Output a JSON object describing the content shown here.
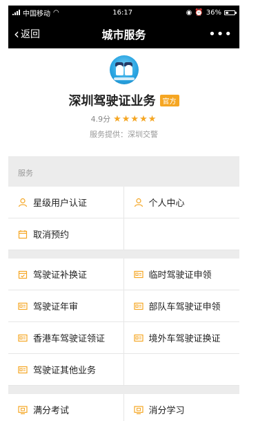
{
  "status_bar": {
    "carrier": "中国移动",
    "time": "16:17",
    "battery": "36%",
    "battery_level": 0.36
  },
  "nav": {
    "back_label": "返回",
    "title": "城市服务",
    "more_label": "•••"
  },
  "service": {
    "name": "深圳驾驶证业务",
    "badge": "官方",
    "score": "4.9分",
    "stars": "★★★★★",
    "provider": "服务提供：深圳交警"
  },
  "sections": {
    "services_title": "服务"
  },
  "group1": [
    {
      "label": "星级用户认证",
      "icon": "user-icon"
    },
    {
      "label": "个人中心",
      "icon": "user-icon"
    },
    {
      "label": "取消预约",
      "icon": "calendar-icon"
    }
  ],
  "group2": [
    {
      "label": "驾驶证补换证",
      "icon": "calendar-check-icon"
    },
    {
      "label": "临时驾驶证申领",
      "icon": "license-card-icon"
    },
    {
      "label": "驾驶证年审",
      "icon": "license-card-icon"
    },
    {
      "label": "部队车驾驶证申领",
      "icon": "license-card-icon"
    },
    {
      "label": "香港车驾驶证领证",
      "icon": "license-card-icon"
    },
    {
      "label": "境外车驾驶证换证",
      "icon": "license-card-icon"
    },
    {
      "label": "驾驶证其他业务",
      "icon": "license-card-icon"
    }
  ],
  "group3": [
    {
      "label": "满分考试",
      "icon": "screen-icon"
    },
    {
      "label": "消分学习",
      "icon": "screen-icon"
    }
  ],
  "colors": {
    "accent": "#f5a623",
    "header_bg": "#000000",
    "section_bg": "#ececec"
  }
}
